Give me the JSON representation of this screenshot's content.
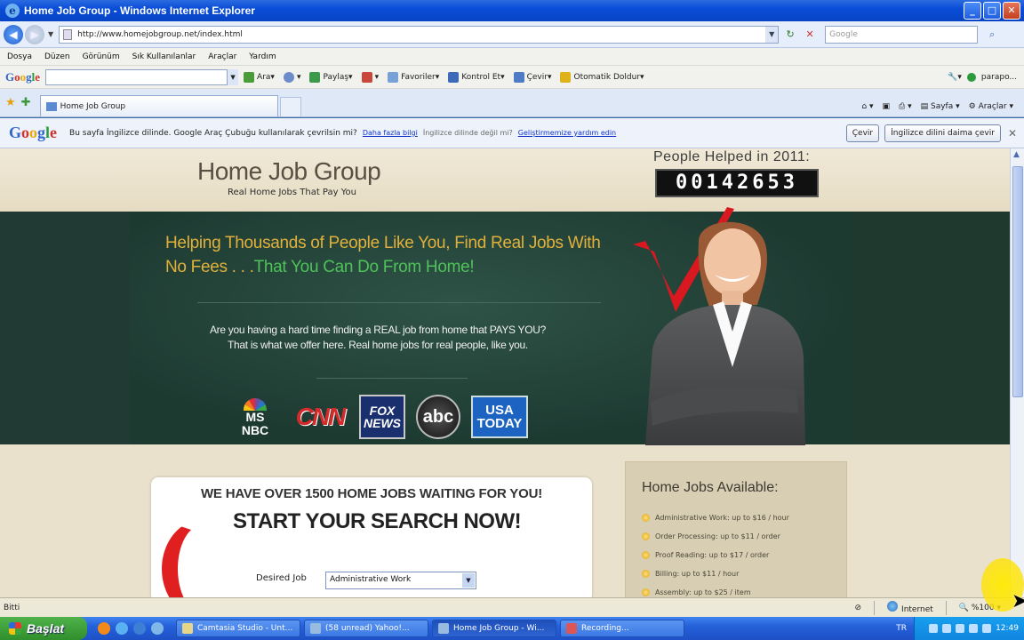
{
  "window": {
    "title": "Home Job Group - Windows Internet Explorer",
    "min": "_",
    "max": "□",
    "close": "✕"
  },
  "address": {
    "url": "http://www.homejobgroup.net/index.html",
    "search_placeholder": "Google"
  },
  "menu": [
    "Dosya",
    "Düzen",
    "Görünüm",
    "Sık Kullanılanlar",
    "Araçlar",
    "Yardım"
  ],
  "google_toolbar": {
    "items": [
      "Ara",
      "Paylaş",
      "Favoriler",
      "Kontrol Et",
      "Çevir",
      "Otomatik Doldur"
    ],
    "profile": "parapo..."
  },
  "tab": {
    "label": "Home Job Group",
    "tools": [
      "Sayfa",
      "Araçlar"
    ]
  },
  "translate_bar": {
    "message": "Bu sayfa İngilizce dilinde. Google Araç Çubuğu kullanılarak çevrilsin mi?",
    "more_link": "Daha fazla bilgi",
    "language_hint": "İngilizce dilinde değil mi?",
    "help_link": "Geliştirmemize yardım edin",
    "translate_button": "Çevir",
    "never_button": "İngilizce dilini daima çevir"
  },
  "site": {
    "brand": "Home Job Group",
    "tagline": "Real Home Jobs That Pay You",
    "counter_label": "People Helped in 2011:",
    "counter_value": "00142653",
    "headline_part1": "Helping Thousands of People Like You, Find Real Jobs With No Fees . . .",
    "headline_part2": "That You Can Do From Home!",
    "subtext_line1": "Are you having a hard time finding a REAL job from home that PAYS YOU?",
    "subtext_line2": "That is what we offer here.  Real home jobs for real people, like you.",
    "media_logos": {
      "msnbc_top": "MS",
      "msnbc_bottom": "NBC",
      "cnn": "CNN",
      "fox_top": "FOX",
      "fox_bottom": "NEWS",
      "abc": "abc",
      "usa_top": "USA",
      "usa_bottom": "TODAY"
    },
    "search_panel": {
      "line1": "WE HAVE OVER 1500 HOME JOBS WAITING FOR YOU!",
      "line2": "START YOUR SEARCH NOW!",
      "desired_label": "Desired Job",
      "desired_value": "Administrative Work"
    },
    "jobs_panel": {
      "title": "Home Jobs Available:",
      "items": [
        "Administrative Work:  up to $16 / hour",
        "Order Processing:  up to $11 / order",
        "Proof Reading:  up to $17 / order",
        "Billing:  up to $11 / hour",
        "Assembly:  up to $25 / item"
      ]
    }
  },
  "status": {
    "left": "Bitti",
    "zone": "Internet",
    "zoom": "%100"
  },
  "taskbar": {
    "start": "Başlat",
    "tasks": [
      "Camtasia Studio - Unt...",
      "(58 unread) Yahoo!...",
      "Home Job Group - Wi...",
      "Recording..."
    ],
    "lang": "TR",
    "clock": "12:49"
  }
}
